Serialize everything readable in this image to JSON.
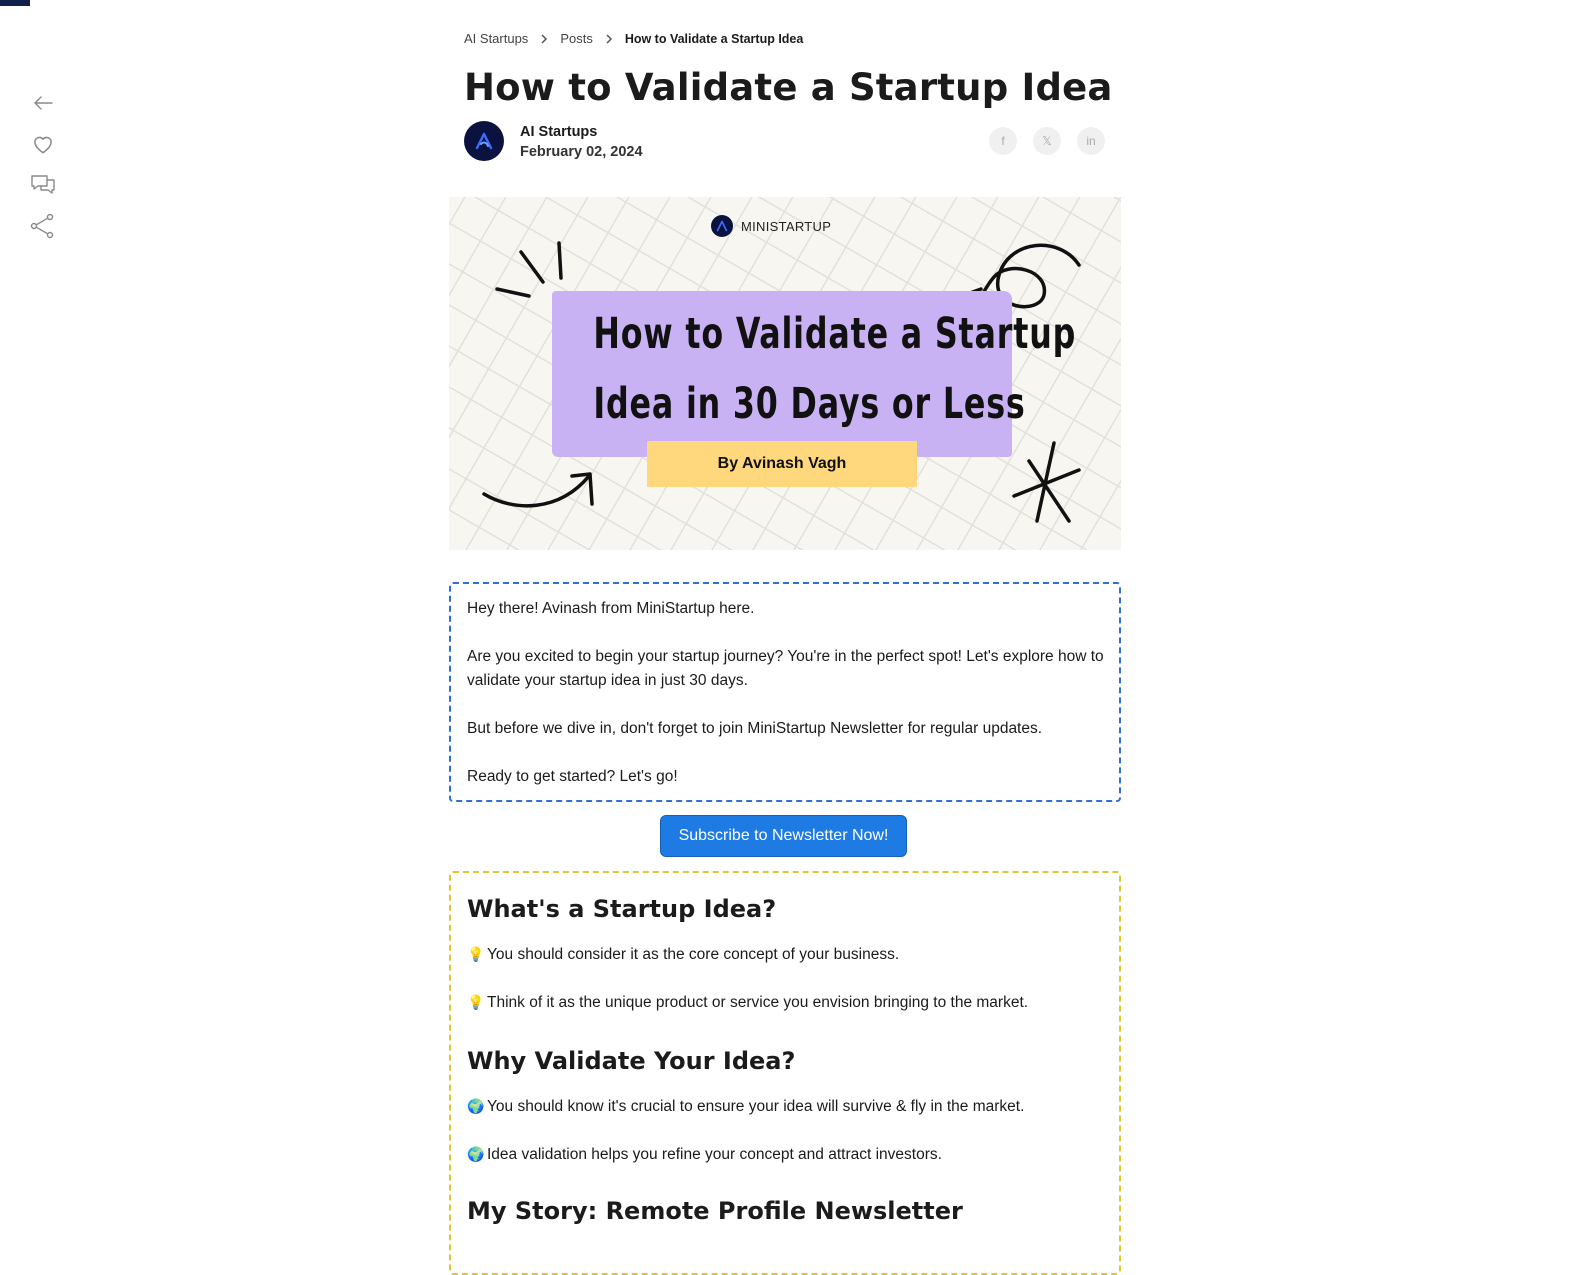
{
  "rail": {
    "back_icon": "arrow-left-icon",
    "like_icon": "heart-icon",
    "comment_icon": "comment-icon",
    "share_icon": "share-icon"
  },
  "breadcrumb": {
    "items": [
      "AI Startups",
      "Posts"
    ],
    "current": "How to Validate a Startup Idea"
  },
  "post": {
    "title": "How to Validate a Startup Idea",
    "author": "AI Startups",
    "date": "February 02, 2024"
  },
  "social": {
    "facebook": "f",
    "x": "𝕏",
    "linkedin": "in"
  },
  "hero": {
    "brand": "MINISTARTUP",
    "headline_line1": "How to Validate a Startup",
    "headline_line2": "Idea in 30 Days or Less",
    "byline": "By Avinash Vagh",
    "colors": {
      "banner": "#c9b2f3",
      "byline": "#ffd77d"
    }
  },
  "intro": {
    "p1": "Hey there! Avinash from MiniStartup here.",
    "p2": "Are you excited to begin your startup journey? You're in the perfect spot! Let's explore how to validate your startup idea in just 30 days.",
    "p3": "But before we dive in, don't forget to join MiniStartup Newsletter for regular updates.",
    "p4": "Ready to get started? Let's go!"
  },
  "cta": {
    "subscribe_label": "Subscribe to Newsletter Now!"
  },
  "content": {
    "section1_heading": "What's a Startup Idea?",
    "section1_bullet_icon": "💡",
    "section1_p1": "You should consider it as the core concept of your business.",
    "section1_p2": "Think of it as the unique product or service you envision bringing to the market.",
    "section2_heading": "Why Validate Your Idea?",
    "section2_bullet_icon": "🌍",
    "section2_p1": "You should know it's crucial to ensure your idea will survive & fly in the market.",
    "section2_p2": "Idea validation helps you refine your concept and attract investors.",
    "section3_heading": "My Story: Remote Profile Newsletter"
  },
  "colors": {
    "intro_border": "#2f6fd6",
    "content_border": "#e2c52f",
    "button": "#1e7be3",
    "avatar": "#0a1240"
  }
}
